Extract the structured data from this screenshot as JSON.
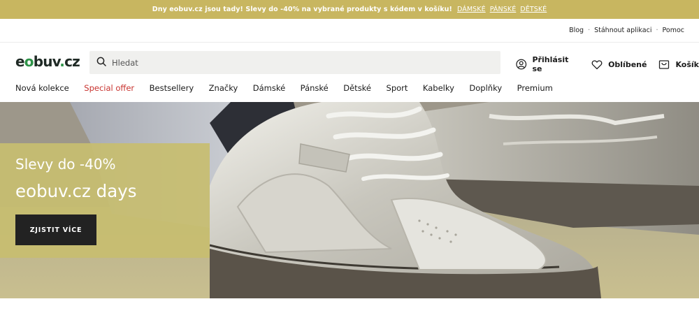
{
  "promo": {
    "text": "Dny eobuv.cz jsou tady! Slevy do -40% na vybrané produkty s kódem v košíku!",
    "links": [
      "DÁMSKÉ",
      "PÁNSKÉ",
      "DĚTSKÉ"
    ]
  },
  "utility": {
    "links": [
      "Blog",
      "Stáhnout aplikaci",
      "Pomoc"
    ],
    "separator": "·"
  },
  "header": {
    "logo": {
      "part1": "e",
      "part2": "o",
      "part3": "buv",
      "part4": ".",
      "part5": "cz"
    },
    "search_placeholder": "Hledat",
    "actions": {
      "login": "Přihlásit se",
      "favorites": "Oblíbené",
      "cart": "Košík"
    }
  },
  "nav": {
    "items": [
      "Nová kolekce",
      "Special offer",
      "Bestsellery",
      "Značky",
      "Dámské",
      "Pánské",
      "Dětské",
      "Sport",
      "Kabelky",
      "Doplňky",
      "Premium"
    ]
  },
  "hero": {
    "subtitle": "Slevy do -40%",
    "title": "eobuv.cz days",
    "cta": "ZJISTIT VÍCE"
  },
  "colors": {
    "promo_bg": "#c8b660",
    "brand_green": "#2e9348",
    "special_offer": "#c8332f",
    "hero_panel": "#c7bd70"
  }
}
